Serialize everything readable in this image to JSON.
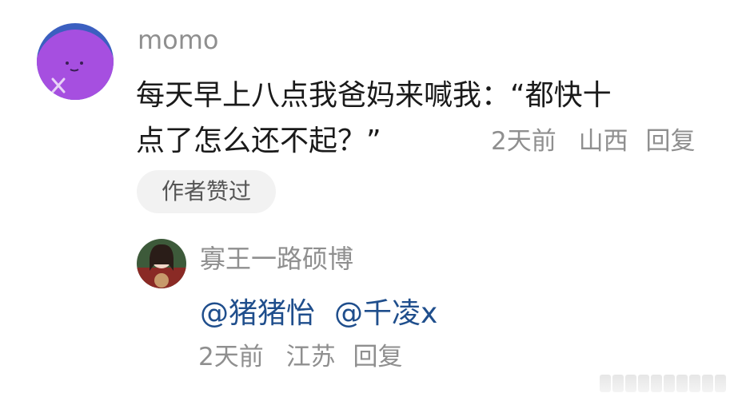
{
  "comment": {
    "username": "momo",
    "text_line1": "每天早上八点我爸妈来喊我：“都快十",
    "text_line2": "点了怎么还不起？”",
    "time": "2天前",
    "location": "山西",
    "reply_label": "回复",
    "liked_badge": "作者赞过"
  },
  "reply": {
    "username": "寡王一路硕博",
    "mentions": [
      "@猪猪怡",
      "@千凌x"
    ],
    "time": "2天前",
    "location": "江苏",
    "reply_label": "回复"
  },
  "colors": {
    "avatar_main": "#a64fe0",
    "mention": "#1f4e8c",
    "meta_text": "#8f8f8f"
  }
}
